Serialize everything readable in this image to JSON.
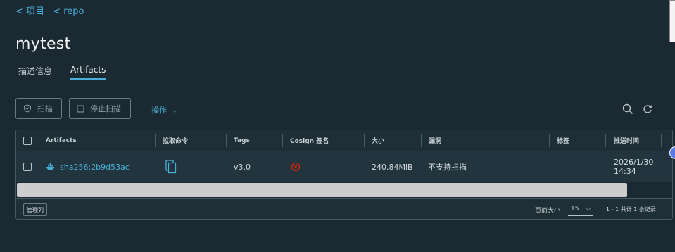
{
  "breadcrumb": {
    "items": [
      "< 项目",
      "< repo"
    ]
  },
  "page_title": "mytest",
  "tabs": [
    {
      "label": "描述信息"
    },
    {
      "label": "Artifacts"
    }
  ],
  "toolbar": {
    "scan_label": "扫描",
    "stop_scan_label": "停止扫描",
    "actions_label": "操作"
  },
  "table": {
    "headers": [
      "Artifacts",
      "拉取命令",
      "Tags",
      "Cosign 签名",
      "大小",
      "漏洞",
      "标签",
      "推送时间"
    ],
    "rows": [
      {
        "artifact": "sha256:2b9d53ac",
        "tags": "v3.0",
        "size": "240.84MiB",
        "vulnerability": "不支持扫描",
        "push_date": "2026/1/30",
        "push_time": "14:34"
      }
    ]
  },
  "footer": {
    "manage_columns_label": "管理列",
    "page_size_label": "页面大小",
    "page_size_value": "15",
    "total_label": "1 - 1 共计 1 条记录"
  },
  "colors": {
    "accent": "#49afd9",
    "background": "#1b2a32",
    "error": "#e12200"
  }
}
